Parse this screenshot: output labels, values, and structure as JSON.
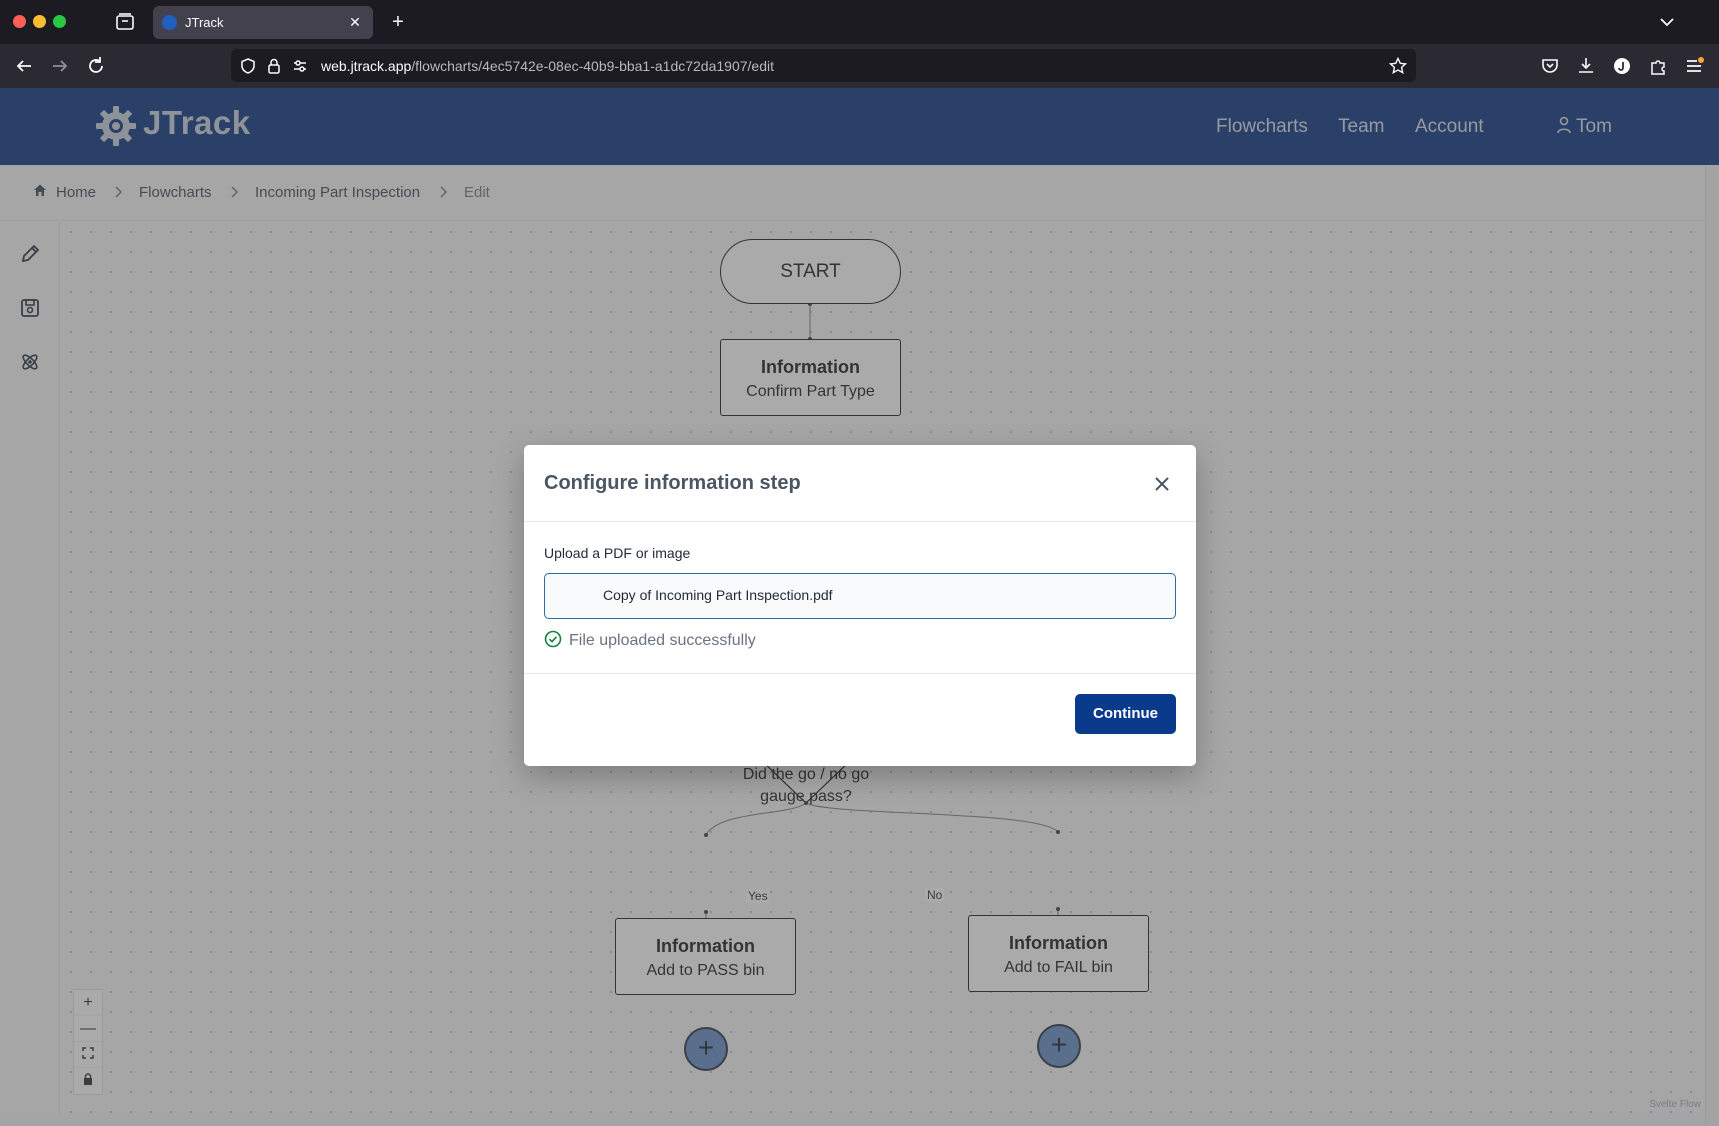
{
  "browser": {
    "tab_title": "JTrack",
    "url_host": "web.jtrack.app",
    "url_path": "/flowcharts/4ec5742e-08ec-40b9-bba1-a1dc72da1907/edit",
    "new_tab_label": "+",
    "tab_close_label": "✕"
  },
  "header": {
    "logo": "JTrack",
    "nav": [
      "Flowcharts",
      "Team",
      "Account"
    ],
    "user": "Tom",
    "brand_color": "#002b7a"
  },
  "breadcrumb": [
    "Home",
    "Flowcharts",
    "Incoming Part Inspection",
    "Edit"
  ],
  "flow": {
    "start": "START",
    "info_title": "Information",
    "confirm": "Confirm Part Type",
    "decision": "Did the go / no go gauge pass?",
    "yes": "Yes",
    "no": "No",
    "pass_bin": "Add to PASS bin",
    "fail_bin": "Add to FAIL bin",
    "add_symbol": "+",
    "attribution": "Svelte Flow"
  },
  "zoom_controls": {
    "zoom_in": "+",
    "zoom_out": "—"
  },
  "modal": {
    "title": "Configure information step",
    "upload_label": "Upload a PDF or image",
    "file_name": "Copy of Incoming Part Inspection.pdf",
    "status": "File uploaded successfully",
    "continue": "Continue",
    "accent_color": "#0a3a8c",
    "success_color": "#15803d"
  }
}
